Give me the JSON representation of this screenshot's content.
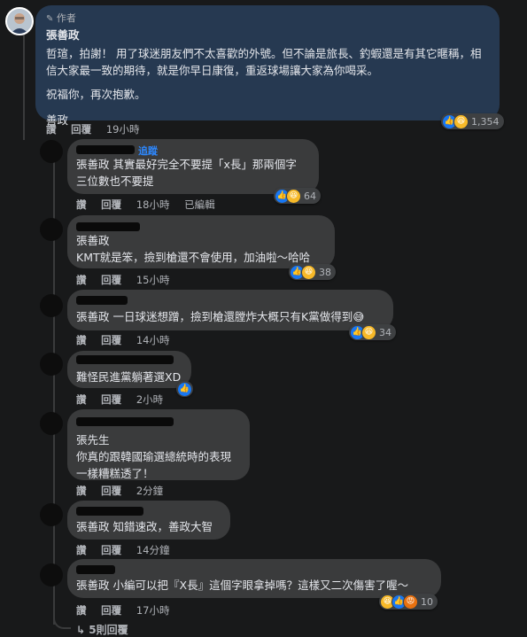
{
  "author_comment": {
    "badge_icon": "pencil-icon",
    "badge_label": "作者",
    "name": "張善政",
    "paragraph1": "哲瑄，拍謝！ 用了球迷朋友們不太喜歡的外號。但不論是旅長、釣蝦還是有其它暱稱，相信大家最一致的期待，就是你早日康復，重返球場讓大家為你喝采。",
    "paragraph2": "祝福你，再次抱歉。",
    "signature": "善政",
    "reactions": {
      "icons": [
        "like-icon",
        "haha-icon"
      ],
      "count": "1,354"
    },
    "actions": {
      "like": "讚",
      "reply": "回覆",
      "time": "19小時"
    }
  },
  "replies": [
    {
      "follow_label": "追蹤",
      "mention": "張善政",
      "line1": "其實最好完全不要提「x長」那兩個字",
      "line2": "三位數也不要提",
      "reactions": {
        "icons": [
          "like-icon",
          "haha-icon"
        ],
        "count": "64"
      },
      "actions": {
        "like": "讚",
        "reply": "回覆",
        "time": "18小時",
        "edited": "已編輯"
      }
    },
    {
      "mention": "張善政",
      "text": "KMT就是笨，撿到槍還不會使用，加油啦～哈哈",
      "reactions": {
        "icons": [
          "like-icon",
          "haha-icon"
        ],
        "count": "38"
      },
      "actions": {
        "like": "讚",
        "reply": "回覆",
        "time": "15小時"
      }
    },
    {
      "mention": "張善政",
      "text": "一日球迷想蹭，撿到槍還膛炸大概只有K黨做得到😅",
      "reactions": {
        "icons": [
          "like-icon",
          "haha-icon"
        ],
        "count": "34"
      },
      "actions": {
        "like": "讚",
        "reply": "回覆",
        "time": "14小時"
      }
    },
    {
      "text": "難怪民進黨躺著選XD",
      "reactions": {
        "icons": [
          "like-icon"
        ],
        "count": ""
      },
      "actions": {
        "like": "讚",
        "reply": "回覆",
        "time": "2小時"
      }
    },
    {
      "line1": "張先生",
      "line2": "你真的跟韓國瑜選總統時的表現",
      "line3": "一樣糟糕透了！",
      "actions": {
        "like": "讚",
        "reply": "回覆",
        "time": "2分鐘"
      }
    },
    {
      "mention": "張善政",
      "text": "知錯速改，善政大智",
      "actions": {
        "like": "讚",
        "reply": "回覆",
        "time": "14分鐘"
      }
    },
    {
      "mention": "張善政",
      "text": "小編可以把『X長』這個字眼拿掉嗎？這樣又二次傷害了喔～",
      "reactions": {
        "icons": [
          "haha-icon",
          "like-icon",
          "angry-icon"
        ],
        "count": "10"
      },
      "actions": {
        "like": "讚",
        "reply": "回覆",
        "time": "17小時"
      }
    }
  ],
  "more_replies": {
    "icon": "reply-arrow-icon",
    "label": "5則回覆"
  }
}
